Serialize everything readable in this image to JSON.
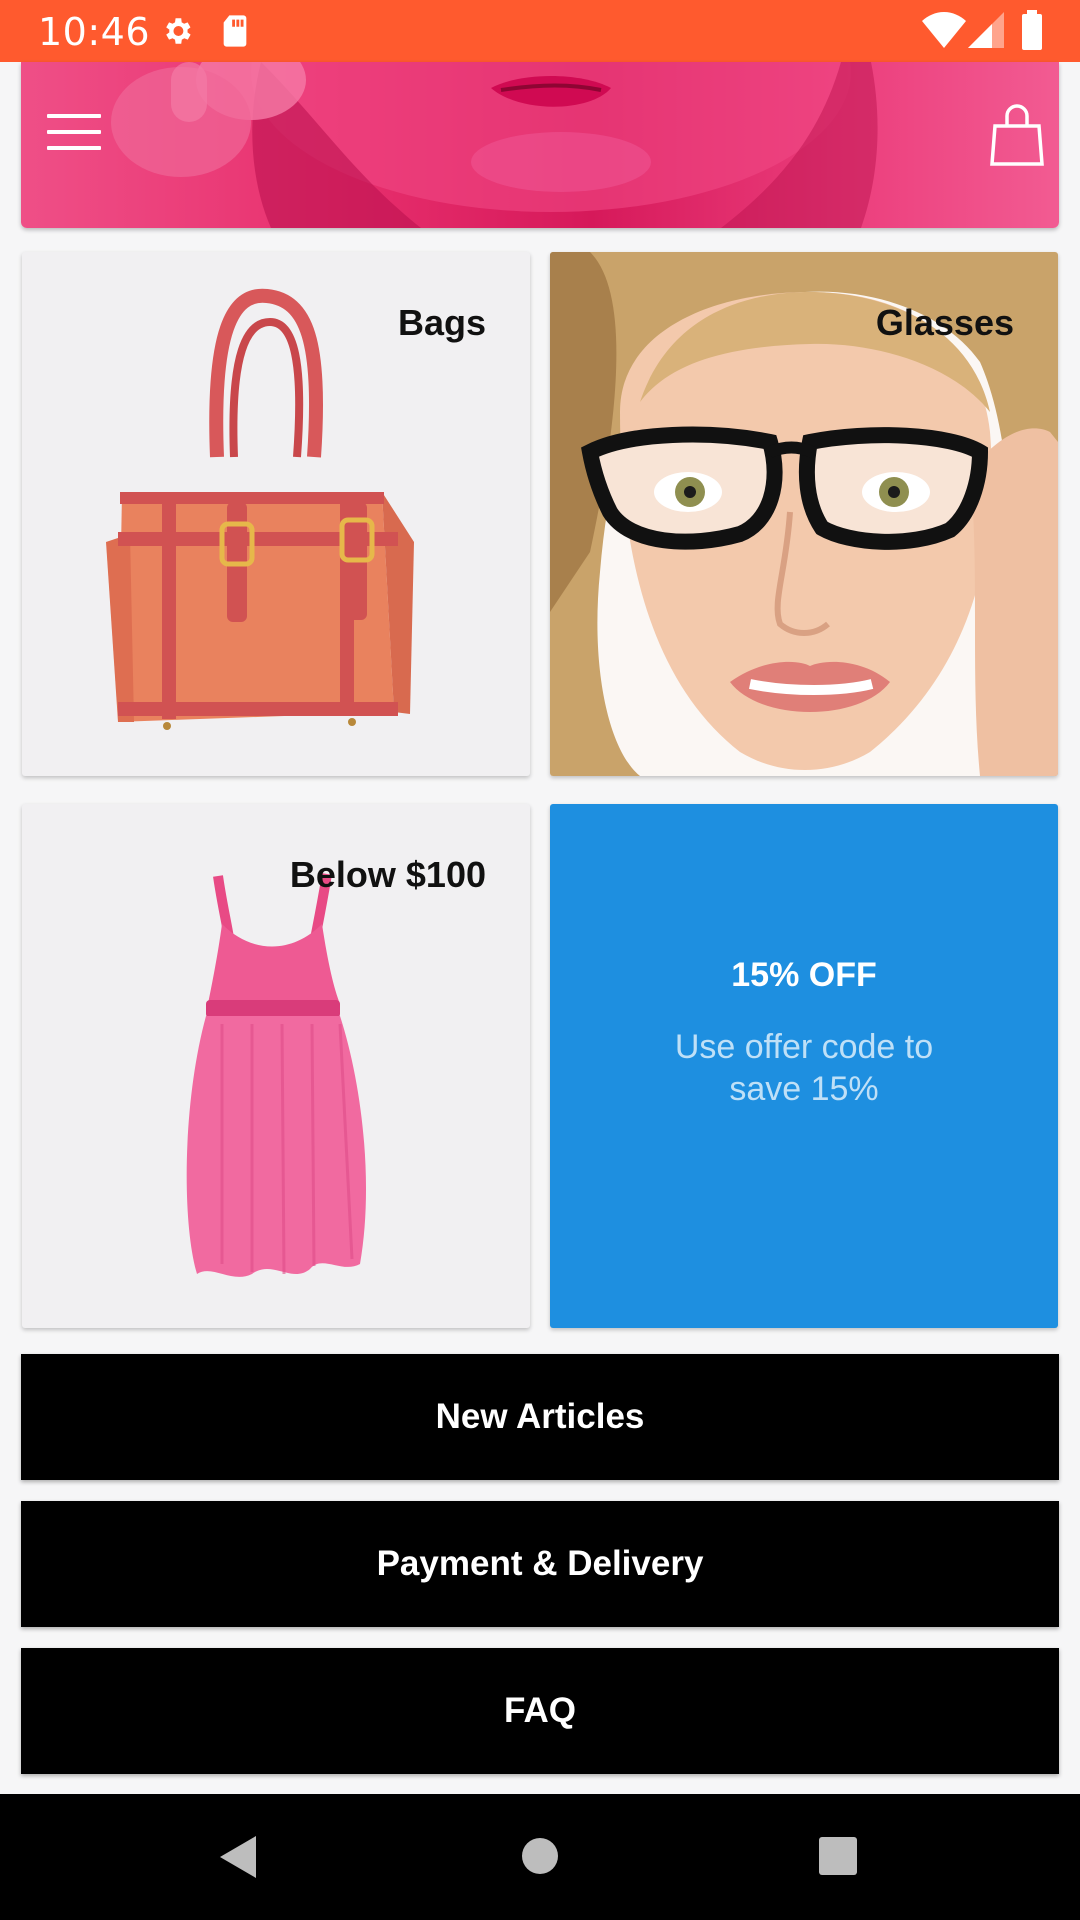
{
  "status_bar": {
    "time": "10:46",
    "icons": [
      "settings-icon",
      "sd-card-icon",
      "wifi-icon",
      "signal-icon",
      "battery-icon"
    ],
    "color": "#ff5a2e"
  },
  "header": {
    "menu_icon": "menu-icon",
    "cart_icon": "shopping-bag-icon"
  },
  "tiles": [
    {
      "label": "Bags",
      "image": "handbag"
    },
    {
      "label": "Glasses",
      "image": "woman-with-glasses"
    },
    {
      "label": "Below $100",
      "image": "pink-dress"
    }
  ],
  "offer": {
    "title": "15% OFF",
    "text": "Use offer code to save 15%",
    "color": "#1e8fe0"
  },
  "links": [
    {
      "label": "New Articles"
    },
    {
      "label": "Payment & Delivery"
    },
    {
      "label": "FAQ"
    }
  ],
  "nav_bar": {
    "icons": [
      "back-icon",
      "home-icon",
      "recents-icon"
    ]
  }
}
